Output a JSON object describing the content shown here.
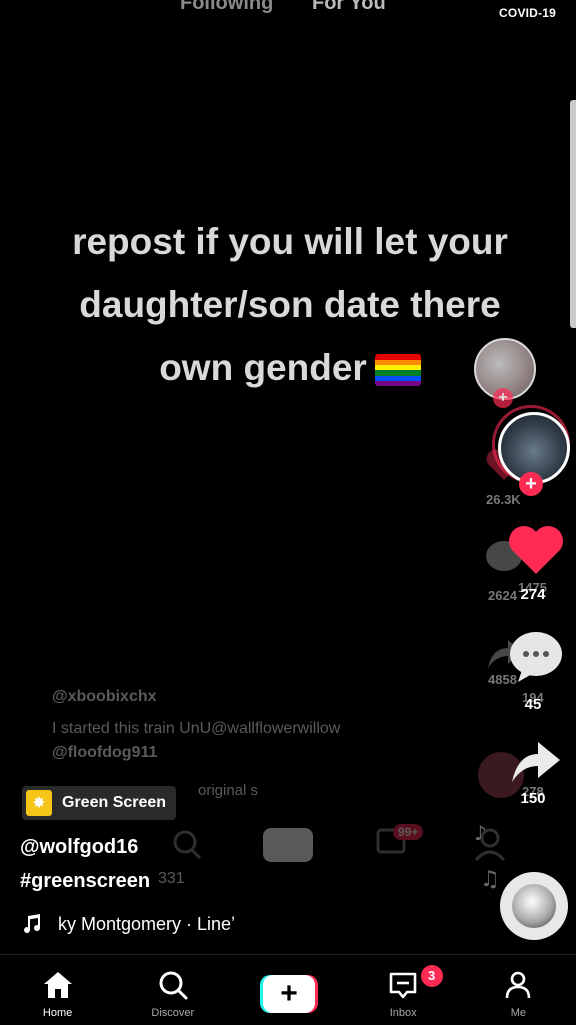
{
  "top": {
    "following_tab": "Following",
    "foryou_tab": "For You",
    "covid_label": "COVID-19"
  },
  "video": {
    "text_line1": "repost if you will let your",
    "text_line2": "daughter/son date there",
    "text_line3": "own gender",
    "flag_colors": [
      "#e40303",
      "#ff8c00",
      "#ffed00",
      "#008026",
      "#004dff",
      "#750787"
    ]
  },
  "ghost_layer": {
    "username1": "@xboobixchx",
    "caption": "I started this train UnU@wallflowerwillow",
    "username2": "@floofdog911",
    "sound": "original s",
    "count": "331",
    "likes": "26.3K",
    "comments": "2624",
    "comments_mid": "1475",
    "shares": "4858",
    "shares_mid": "194",
    "extra_mid": "278",
    "inbox_badge": "99+"
  },
  "actions": {
    "likes": "274",
    "comments": "45",
    "shares": "150",
    "like_color": "#fe2c55"
  },
  "info": {
    "effect": "Green Screen",
    "username": "@wolfgod16",
    "hashtag": "#greenscreen",
    "sound": "ky Montgomery · Lineʼ"
  },
  "nav": {
    "home": "Home",
    "discover": "Discover",
    "inbox": "Inbox",
    "inbox_badge": "3",
    "me": "Me"
  },
  "colors": {
    "accent": "#fe2c55",
    "cyan": "#25f4ee"
  }
}
